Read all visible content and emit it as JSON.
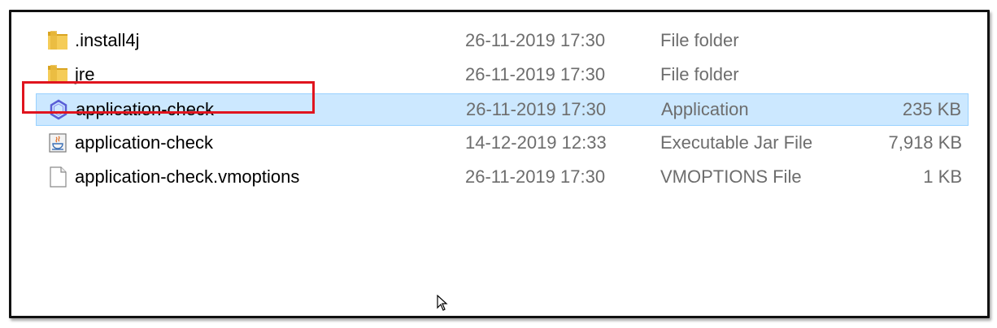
{
  "files": [
    {
      "name": ".install4j",
      "date": "26-11-2019 17:30",
      "type": "File folder",
      "size": "",
      "icon": "folder-icon"
    },
    {
      "name": "jre",
      "date": "26-11-2019 17:30",
      "type": "File folder",
      "size": "",
      "icon": "folder-icon"
    },
    {
      "name": "application-check",
      "date": "26-11-2019 17:30",
      "type": "Application",
      "size": "235 KB",
      "icon": "application-hexagon-icon",
      "selected": true
    },
    {
      "name": "application-check",
      "date": "14-12-2019 12:33",
      "type": "Executable Jar File",
      "size": "7,918 KB",
      "icon": "java-jar-icon"
    },
    {
      "name": "application-check.vmoptions",
      "date": "26-11-2019 17:30",
      "type": "VMOPTIONS File",
      "size": "1 KB",
      "icon": "blank-file-icon"
    }
  ],
  "colors": {
    "selection_bg": "#cce8ff",
    "selection_border": "#99d1ff",
    "highlight": "#e0141e",
    "folder": "#e8b83a"
  }
}
